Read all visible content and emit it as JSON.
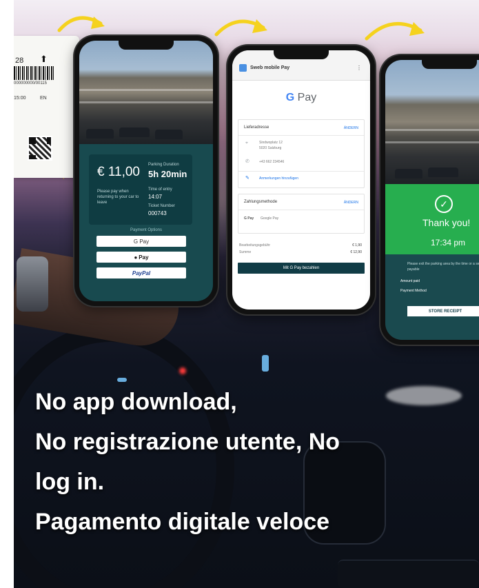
{
  "ticket": {
    "number": "28",
    "serial": "000000000/00115",
    "time": "15:00",
    "lang": "EN"
  },
  "phone1": {
    "price": "€ 11,00",
    "duration_label": "Parking Duration",
    "duration_value": "5h 20min",
    "pay_hint": "Please pay when returning to your car to leave",
    "entry_label": "Time of entry",
    "entry_value": "14:07",
    "ticket_label": "Ticket Number",
    "ticket_value": "000743",
    "payment_options": "Payment Options",
    "buttons": [
      "G Pay",
      "Pay",
      "PayPal"
    ]
  },
  "phone2": {
    "app_title": "Sweb mobile Pay",
    "gpay": "Pay",
    "address_head": "Lieferadresse",
    "change": "ÄNDERN",
    "address_line1": "Sindwoplatz 12",
    "address_line2": "5020 Salzburg",
    "phone": "+43 662 234546",
    "notes": "Anmerkungen hinzufügen",
    "payment_head": "Zahlungsmethode",
    "method": "Google Pay",
    "fee_label": "Bearbeitungsgebühr",
    "fee_value": "€ 1,90",
    "sum_label": "Summe",
    "sum_value": "€ 12,90",
    "confirm": "Mit G Pay bezahlen"
  },
  "phone3": {
    "thanks": "Thank you!",
    "time": "17:34 pm",
    "note": "Please exit the parking area by the time or a second fee will be payable",
    "amount_label": "Amount paid",
    "method_label": "Payment Method",
    "store": "STORE RECEIPT"
  },
  "headline": {
    "line1": "No app download,",
    "line2": "No registrazione utente, No",
    "line3": "log in.",
    "line4": "Pagamento digitale veloce"
  },
  "colors": {
    "accent_teal": "#184a4f",
    "success_green": "#27ae4f",
    "arrow_yellow": "#f5d21e"
  }
}
